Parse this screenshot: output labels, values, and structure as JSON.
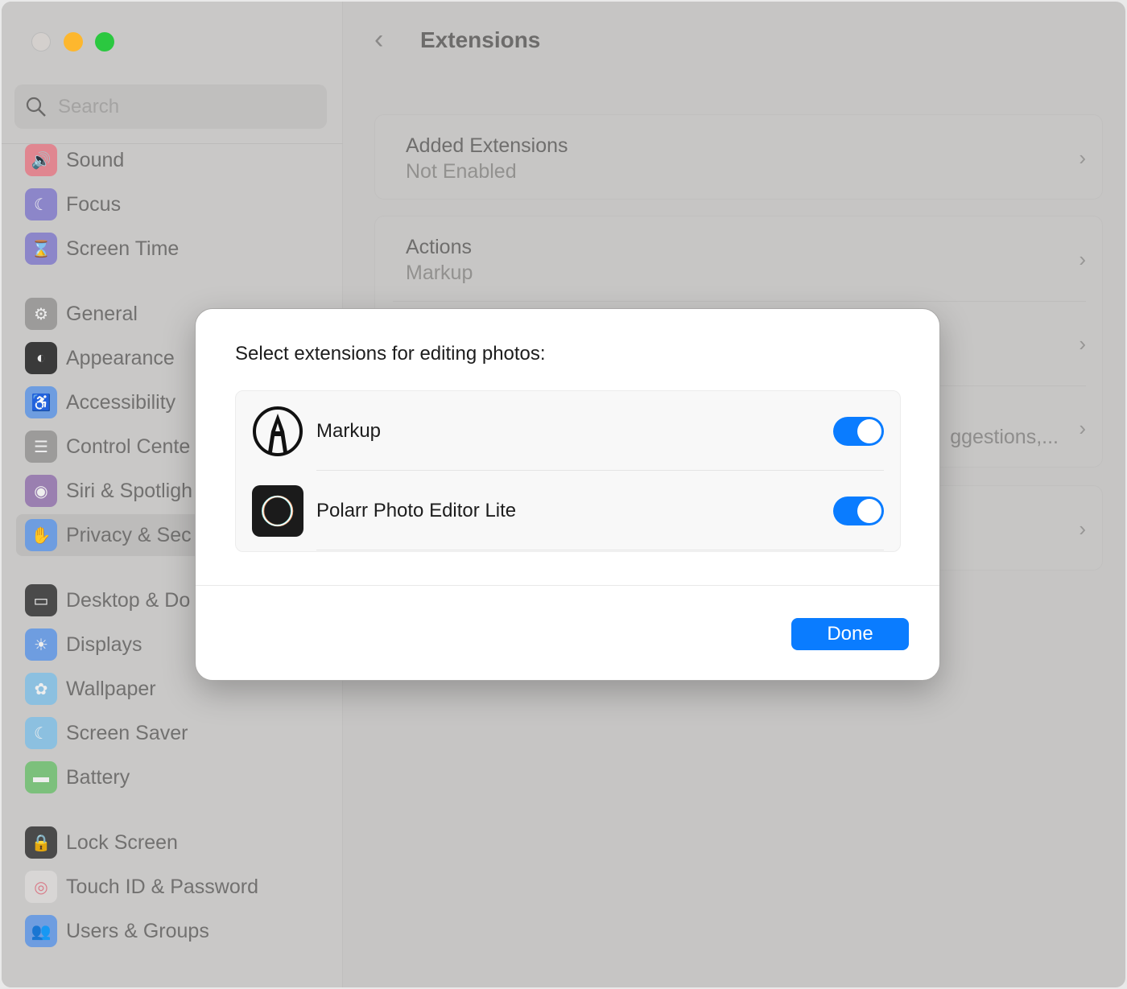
{
  "window": {
    "title": "Extensions"
  },
  "search": {
    "placeholder": "Search"
  },
  "sidebar": {
    "items": [
      {
        "label": "Sound",
        "icon": "speaker-icon",
        "color": "#e08690"
      },
      {
        "label": "Focus",
        "icon": "moon-icon",
        "color": "#8c86c9"
      },
      {
        "label": "Screen Time",
        "icon": "hourglass-icon",
        "color": "#8c86c9"
      },
      {
        "label": "General",
        "icon": "gear-icon",
        "color": "#9c9b9a"
      },
      {
        "label": "Appearance",
        "icon": "appearance-icon",
        "color": "#3a3a3a"
      },
      {
        "label": "Accessibility",
        "icon": "accessibility-icon",
        "color": "#6e9de0"
      },
      {
        "label": "Control Cente",
        "icon": "control-center-icon",
        "color": "#9c9b9a"
      },
      {
        "label": "Siri & Spotligh",
        "icon": "siri-icon",
        "color": "#9a7fb0"
      },
      {
        "label": "Privacy & Sec",
        "icon": "hand-icon",
        "color": "#6e9de0"
      },
      {
        "label": "Desktop & Do",
        "icon": "desktop-icon",
        "color": "#4a4a4a"
      },
      {
        "label": "Displays",
        "icon": "sun-icon",
        "color": "#6e9de0"
      },
      {
        "label": "Wallpaper",
        "icon": "flower-icon",
        "color": "#8cc0e0"
      },
      {
        "label": "Screen Saver",
        "icon": "screensaver-icon",
        "color": "#8cc0e0"
      },
      {
        "label": "Battery",
        "icon": "battery-icon",
        "color": "#7cc07c"
      },
      {
        "label": "Lock Screen",
        "icon": "lock-icon",
        "color": "#4a4a4a"
      },
      {
        "label": "Touch ID & Password",
        "icon": "fingerprint-icon",
        "color": "#d8d6d5"
      },
      {
        "label": "Users & Groups",
        "icon": "users-icon",
        "color": "#6e9de0"
      }
    ]
  },
  "main": {
    "cards": [
      {
        "title": "Added Extensions",
        "subtitle": "Not Enabled"
      },
      {
        "title": "Actions",
        "subtitle": "Markup"
      },
      {
        "partial": "ggestions,..."
      }
    ]
  },
  "dialog": {
    "title": "Select extensions for editing photos:",
    "items": [
      {
        "name": "Markup",
        "enabled": true
      },
      {
        "name": "Polarr Photo Editor Lite",
        "enabled": true
      }
    ],
    "done": "Done"
  },
  "colors": {
    "accent": "#0a7cff"
  }
}
